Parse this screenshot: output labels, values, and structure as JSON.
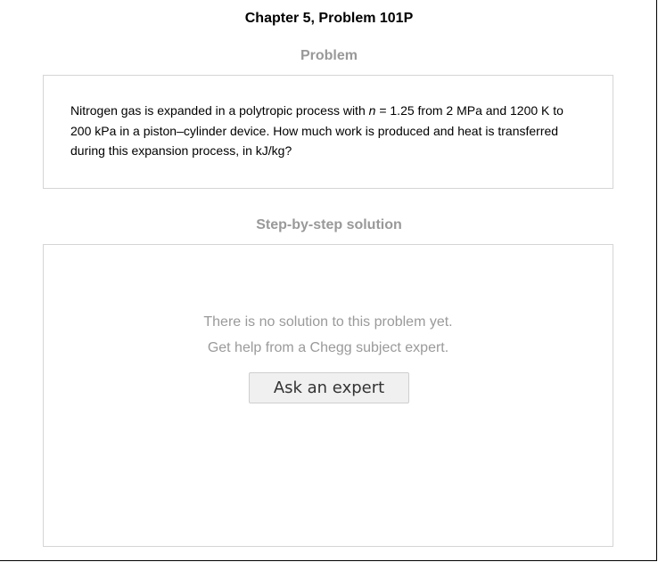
{
  "header": {
    "chapter_title": "Chapter 5, Problem 101P"
  },
  "problem": {
    "heading": "Problem",
    "text_before_var": "Nitrogen gas is expanded in a polytropic process with ",
    "variable": "n",
    "text_after_var": " = 1.25 from 2 MPa and 1200 K to 200 kPa in a piston–cylinder device. How much work is produced and heat is transferred during this expansion process, in kJ/kg?"
  },
  "solution": {
    "heading": "Step-by-step solution",
    "no_solution_message": "There is no solution to this problem yet.",
    "help_message": "Get help from a Chegg subject expert.",
    "ask_button_label": "Ask an expert"
  }
}
